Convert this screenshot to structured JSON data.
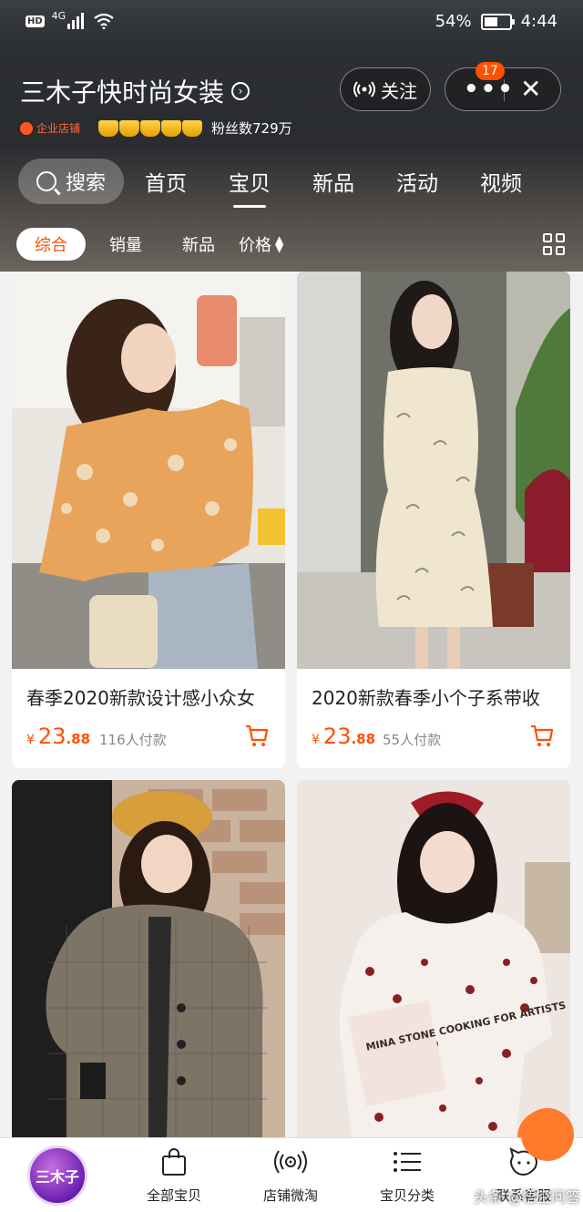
{
  "status_bar": {
    "hd": "HD",
    "network": "4G",
    "battery_percent": "54%",
    "battery_level": 0.54,
    "time": "4:44"
  },
  "shop": {
    "name": "三木子快时尚女装",
    "follow_label": "关注",
    "more_badge": "17",
    "enterprise_tag": "企业店铺",
    "crown_count": 5,
    "fans": "粉丝数729万"
  },
  "nav": {
    "search_label": "搜索",
    "tabs": [
      "首页",
      "宝贝",
      "新品",
      "活动",
      "视频"
    ],
    "active_tab": "宝贝"
  },
  "sort": {
    "items": [
      "综合",
      "销量",
      "新品",
      "价格"
    ],
    "active": "综合"
  },
  "products": [
    {
      "title": "春季2020新款设计感小众女",
      "currency": "¥",
      "price_int": "23",
      "price_dec": ".88",
      "sold": "116人付款"
    },
    {
      "title": "2020新款春季小个子系带收",
      "currency": "¥",
      "price_int": "23",
      "price_dec": ".88",
      "sold": "55人付款"
    },
    {
      "title": "",
      "currency": "",
      "price_int": "",
      "price_dec": "",
      "sold": ""
    },
    {
      "title": "",
      "currency": "",
      "price_int": "",
      "price_dec": "",
      "sold": ""
    }
  ],
  "book_text": "MINA STONE COOKING FOR ARTISTS",
  "bottom_bar": {
    "logo_text": "三木子",
    "tabs": [
      {
        "label": "全部宝贝",
        "icon": "shopping-bag-icon"
      },
      {
        "label": "店铺微淘",
        "icon": "broadcast-icon"
      },
      {
        "label": "宝贝分类",
        "icon": "list-icon"
      },
      {
        "label": "联系客服",
        "icon": "chat-face-icon"
      }
    ]
  },
  "watermark": "头条 @悟空问答",
  "colors": {
    "accent": "#ff5000",
    "header_dark": "#2c2f33"
  }
}
